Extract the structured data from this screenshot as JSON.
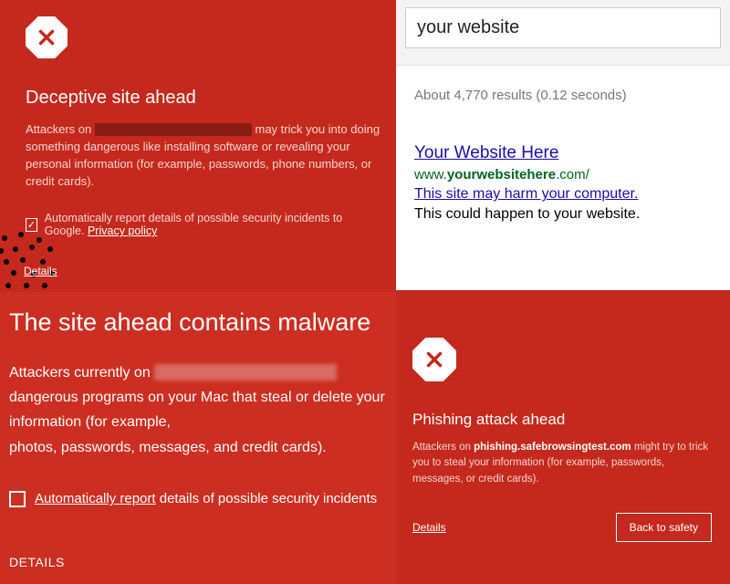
{
  "deceptive": {
    "heading": "Deceptive site ahead",
    "body_pre": "Attackers on ",
    "body_post": " may trick you into doing something dangerous like installing software or revealing your personal information (for example, passwords, phone numbers, or credit cards).",
    "checkbox_label": "Automatically report details of possible security incidents to Google. ",
    "privacy": "Privacy policy",
    "details": "Details"
  },
  "malware": {
    "heading": "The site ahead contains malware",
    "body_pre": "Attackers currently on ",
    "body_line2": "dangerous programs on your Mac that steal or delete your information (for example,",
    "body_line3": "photos, passwords, messages, and credit cards).",
    "auto_report_strong": "Automatically report",
    "auto_report_rest": " details of possible security incidents",
    "details": "DETAILS"
  },
  "search": {
    "query": "your website",
    "stats": "About 4,770 results (0.12 seconds)",
    "result_title": "Your Website Here",
    "result_url_pre": "www.",
    "result_url_bold": "yourwebsitehere",
    "result_url_post": ".com/",
    "result_warn": "This site may harm your computer.",
    "result_note": "This could happen to your website."
  },
  "phish": {
    "heading": "Phishing attack ahead",
    "body_pre": "Attackers on ",
    "domain": "phishing.safebrowsingtest.com",
    "body_post": " might try to trick you to steal your information (for example, passwords, messages, or credit cards).",
    "details": "Details",
    "back": "Back to safety"
  }
}
